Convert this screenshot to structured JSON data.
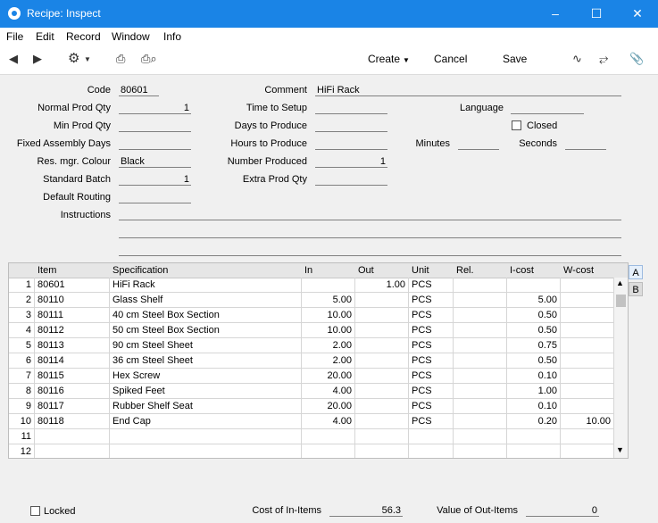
{
  "window": {
    "title": "Recipe: Inspect"
  },
  "menu": [
    "File",
    "Edit",
    "Record",
    "Window",
    "Info"
  ],
  "toolbar": {
    "create": "Create",
    "cancel": "Cancel",
    "save": "Save"
  },
  "form": {
    "code_label": "Code",
    "code": "80601",
    "normal_prod_qty_label": "Normal Prod Qty",
    "normal_prod_qty": "1",
    "min_prod_qty_label": "Min Prod Qty",
    "min_prod_qty": "",
    "fixed_assembly_days_label": "Fixed Assembly Days",
    "fixed_assembly_days": "",
    "res_mgr_colour_label": "Res. mgr. Colour",
    "res_mgr_colour": "Black",
    "standard_batch_label": "Standard Batch",
    "standard_batch": "1",
    "default_routing_label": "Default Routing",
    "default_routing": "",
    "instructions_label": "Instructions",
    "comment_label": "Comment",
    "comment": "HiFi Rack",
    "time_to_setup_label": "Time to Setup",
    "time_to_setup": "",
    "days_to_produce_label": "Days to Produce",
    "days_to_produce": "",
    "hours_to_produce_label": "Hours to Produce",
    "hours_to_produce": "",
    "number_produced_label": "Number Produced",
    "number_produced": "1",
    "extra_prod_qty_label": "Extra Prod Qty",
    "extra_prod_qty": "",
    "language_label": "Language",
    "language": "",
    "closed_label": "Closed",
    "minutes_label": "Minutes",
    "minutes": "",
    "seconds_label": "Seconds",
    "seconds": ""
  },
  "grid": {
    "columns": [
      "Item",
      "Specification",
      "In",
      "Out",
      "Unit",
      "Rel.",
      "I-cost",
      "W-cost"
    ],
    "rows": [
      {
        "n": "1",
        "item": "80601",
        "spec": "HiFi Rack",
        "in": "",
        "out": "1.00",
        "unit": "PCS",
        "rel": "",
        "icost": "",
        "wcost": ""
      },
      {
        "n": "2",
        "item": "80110",
        "spec": "Glass Shelf",
        "in": "5.00",
        "out": "",
        "unit": "PCS",
        "rel": "",
        "icost": "5.00",
        "wcost": ""
      },
      {
        "n": "3",
        "item": "80111",
        "spec": "40 cm Steel Box Section",
        "in": "10.00",
        "out": "",
        "unit": "PCS",
        "rel": "",
        "icost": "0.50",
        "wcost": ""
      },
      {
        "n": "4",
        "item": "80112",
        "spec": "50 cm Steel Box Section",
        "in": "10.00",
        "out": "",
        "unit": "PCS",
        "rel": "",
        "icost": "0.50",
        "wcost": ""
      },
      {
        "n": "5",
        "item": "80113",
        "spec": "90 cm Steel Sheet",
        "in": "2.00",
        "out": "",
        "unit": "PCS",
        "rel": "",
        "icost": "0.75",
        "wcost": ""
      },
      {
        "n": "6",
        "item": "80114",
        "spec": "36 cm Steel Sheet",
        "in": "2.00",
        "out": "",
        "unit": "PCS",
        "rel": "",
        "icost": "0.50",
        "wcost": ""
      },
      {
        "n": "7",
        "item": "80115",
        "spec": "Hex Screw",
        "in": "20.00",
        "out": "",
        "unit": "PCS",
        "rel": "",
        "icost": "0.10",
        "wcost": ""
      },
      {
        "n": "8",
        "item": "80116",
        "spec": "Spiked Feet",
        "in": "4.00",
        "out": "",
        "unit": "PCS",
        "rel": "",
        "icost": "1.00",
        "wcost": ""
      },
      {
        "n": "9",
        "item": "80117",
        "spec": "Rubber Shelf Seat",
        "in": "20.00",
        "out": "",
        "unit": "PCS",
        "rel": "",
        "icost": "0.10",
        "wcost": ""
      },
      {
        "n": "10",
        "item": "80118",
        "spec": "End Cap",
        "in": "4.00",
        "out": "",
        "unit": "PCS",
        "rel": "",
        "icost": "0.20",
        "wcost": "10.00"
      },
      {
        "n": "11",
        "item": "",
        "spec": "",
        "in": "",
        "out": "",
        "unit": "",
        "rel": "",
        "icost": "",
        "wcost": ""
      },
      {
        "n": "12",
        "item": "",
        "spec": "",
        "in": "",
        "out": "",
        "unit": "",
        "rel": "",
        "icost": "",
        "wcost": ""
      }
    ]
  },
  "tabs": [
    "A",
    "B"
  ],
  "footer": {
    "locked_label": "Locked",
    "cost_in_label": "Cost of In-Items",
    "cost_in": "56.3",
    "value_out_label": "Value of Out-Items",
    "value_out": "0"
  }
}
